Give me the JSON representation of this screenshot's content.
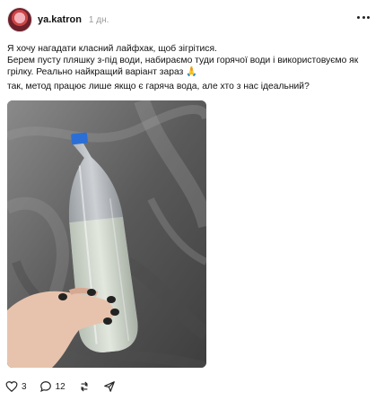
{
  "post": {
    "username": "ya.katron",
    "time": "1 дн.",
    "text1_line1": "Я хочу нагадати класний лайфхак, щоб зігрітися.",
    "text1_line2": "Берем пусту пляшку з-під води, набираємо туди горячої води і використовуємо як",
    "text1_line3": "грілку. Реально найкращий варіант зараз 🙏",
    "text2": "так, метод працює лише якщо є гаряча вода, але хто з нас ідеальний?"
  },
  "actions": {
    "likes": "3",
    "comments": "12"
  },
  "icons": [
    "heart-icon",
    "comment-icon",
    "repost-icon",
    "share-icon",
    "more-icon"
  ],
  "colors": {
    "text": "#111111",
    "muted": "#9a9a9a",
    "bottle_cap": "#2b6fd6"
  }
}
